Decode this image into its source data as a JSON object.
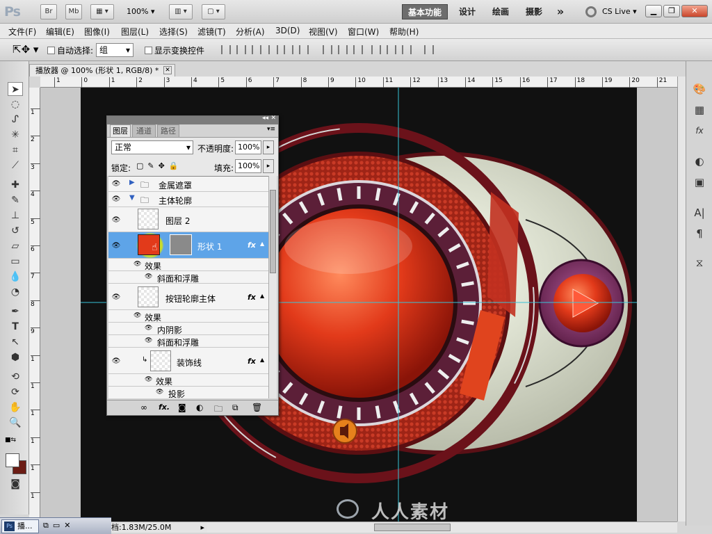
{
  "appbar": {
    "logo": "Ps",
    "bridge_label": "Br",
    "minibridge_label": "Mb",
    "zoom": "100%",
    "workspaces": [
      "基本功能",
      "设计",
      "绘画",
      "摄影"
    ],
    "more_label": "»",
    "cslive_label": "CS Live"
  },
  "menu": [
    "文件(F)",
    "编辑(E)",
    "图像(I)",
    "图层(L)",
    "选择(S)",
    "滤镜(T)",
    "分析(A)",
    "3D(D)",
    "视图(V)",
    "窗口(W)",
    "帮助(H)"
  ],
  "options": {
    "auto_select_label": "自动选择:",
    "auto_select_value": "组",
    "show_transform_label": "显示变换控件"
  },
  "document": {
    "tab_title": "播放器 @ 100% (形状 1, RGB/8) *",
    "hruler_ticks": [
      "1",
      "0",
      "1",
      "2",
      "3",
      "4",
      "5",
      "6",
      "7",
      "8",
      "9",
      "10",
      "11",
      "12",
      "13",
      "14",
      "15",
      "16",
      "17",
      "18",
      "19",
      "20",
      "21"
    ],
    "vruler_ticks": [
      "1",
      "2",
      "3",
      "4",
      "5",
      "6",
      "7",
      "8",
      "9",
      "1",
      "1",
      "1",
      "1",
      "1",
      "1",
      "1"
    ],
    "status": "档:1.83M/25.0M",
    "watermark": "人人素材"
  },
  "layers_panel": {
    "tabs": [
      "图层",
      "通道",
      "路径"
    ],
    "blend_mode": "正常",
    "opacity_label": "不透明度:",
    "opacity_value": "100%",
    "lock_label": "锁定:",
    "fill_label": "填充:",
    "fill_value": "100%",
    "rows": [
      {
        "name": "金属遮罩",
        "kind": "group-collapsed"
      },
      {
        "name": "主体轮廓",
        "kind": "group-expanded"
      },
      {
        "name": "图层 2",
        "kind": "layer"
      },
      {
        "name": "形状 1",
        "kind": "shape-selected",
        "fx": "fx"
      },
      {
        "name": "效果",
        "kind": "effects"
      },
      {
        "name": "斜面和浮雕",
        "kind": "effect"
      },
      {
        "name": "按钮轮廓主体",
        "kind": "layer",
        "fx": "fx"
      },
      {
        "name": "效果",
        "kind": "effects"
      },
      {
        "name": "内阴影",
        "kind": "effect"
      },
      {
        "name": "斜面和浮雕",
        "kind": "effect"
      },
      {
        "name": "装饰线",
        "kind": "clipped",
        "fx": "fx"
      },
      {
        "name": "效果",
        "kind": "effects"
      },
      {
        "name": "投影",
        "kind": "effect"
      }
    ],
    "footer_fx": "fx."
  },
  "taskbar": {
    "item_label": "播..."
  },
  "colors": {
    "guide": "#38c4d8",
    "selected_row": "#5ea4e8",
    "button_red": "#e23a1a"
  }
}
